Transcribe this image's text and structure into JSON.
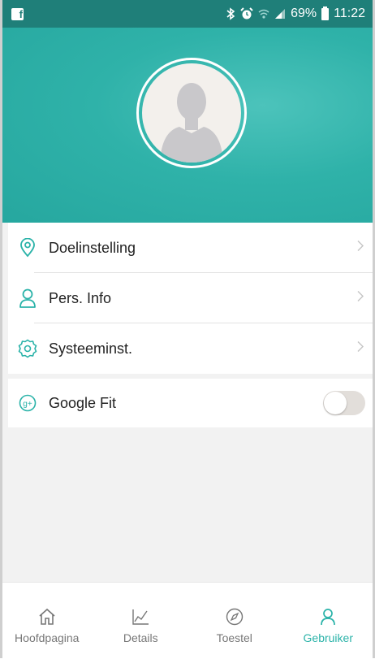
{
  "status_bar": {
    "battery": "69%",
    "time": "11:22",
    "app_icon": "facebook-icon",
    "icons": [
      "bluetooth-icon",
      "alarm-icon",
      "wifi-icon",
      "signal-icon",
      "battery-icon"
    ]
  },
  "header": {
    "background": "#2fb2a9",
    "avatar_icon": "person-icon"
  },
  "menu": {
    "items": [
      {
        "label": "Doelinstelling",
        "icon": "location-pin-icon"
      },
      {
        "label": "Pers. Info",
        "icon": "user-icon"
      },
      {
        "label": "Systeeminst.",
        "icon": "gear-icon"
      }
    ]
  },
  "google_fit": {
    "label": "Google Fit",
    "icon": "google-plus-icon",
    "enabled": false
  },
  "bottom_nav": {
    "items": [
      {
        "label": "Hoofdpagina",
        "icon": "home-icon",
        "active": false
      },
      {
        "label": "Details",
        "icon": "chart-icon",
        "active": false
      },
      {
        "label": "Toestel",
        "icon": "compass-icon",
        "active": false
      },
      {
        "label": "Gebruiker",
        "icon": "user-icon",
        "active": true
      }
    ]
  },
  "colors": {
    "accent": "#2bb3a9",
    "status_bar": "#1f7f79"
  }
}
